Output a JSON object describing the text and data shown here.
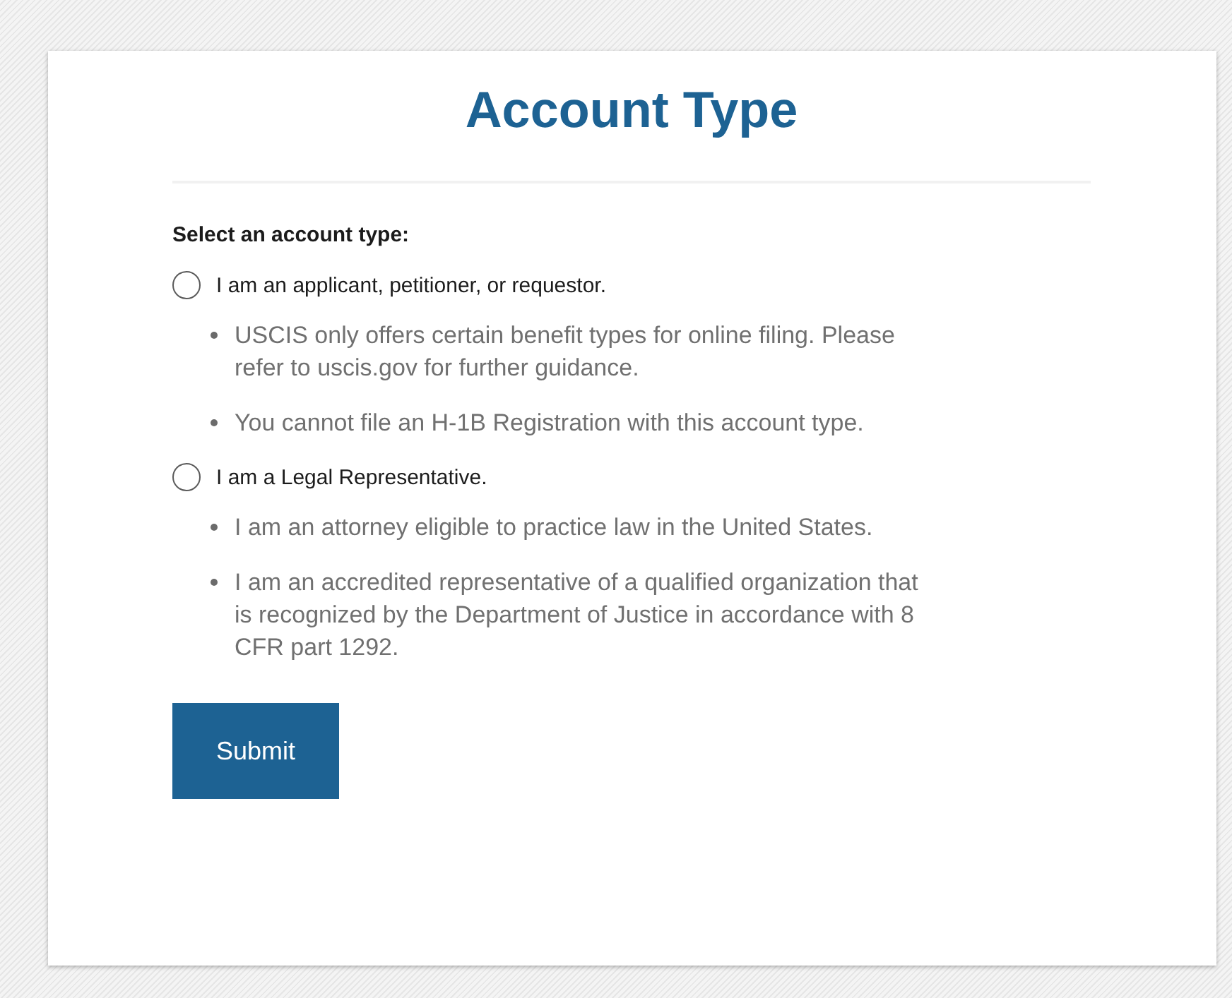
{
  "title": "Account Type",
  "prompt": "Select an account type:",
  "options": [
    {
      "label": "I am an applicant, petitioner, or requestor.",
      "selected": false,
      "notes": [
        "USCIS only offers certain benefit types for online filing. Please refer to uscis.gov for further guidance.",
        "You cannot file an H-1B Registration with this account type."
      ]
    },
    {
      "label": "I am a Legal Representative.",
      "selected": false,
      "notes": [
        "I am an attorney eligible to practice law in the United States.",
        "I am an accredited representative of a qualified organization that is recognized by the Department of Justice in accordance with 8 CFR part 1292."
      ]
    }
  ],
  "submit": "Submit"
}
